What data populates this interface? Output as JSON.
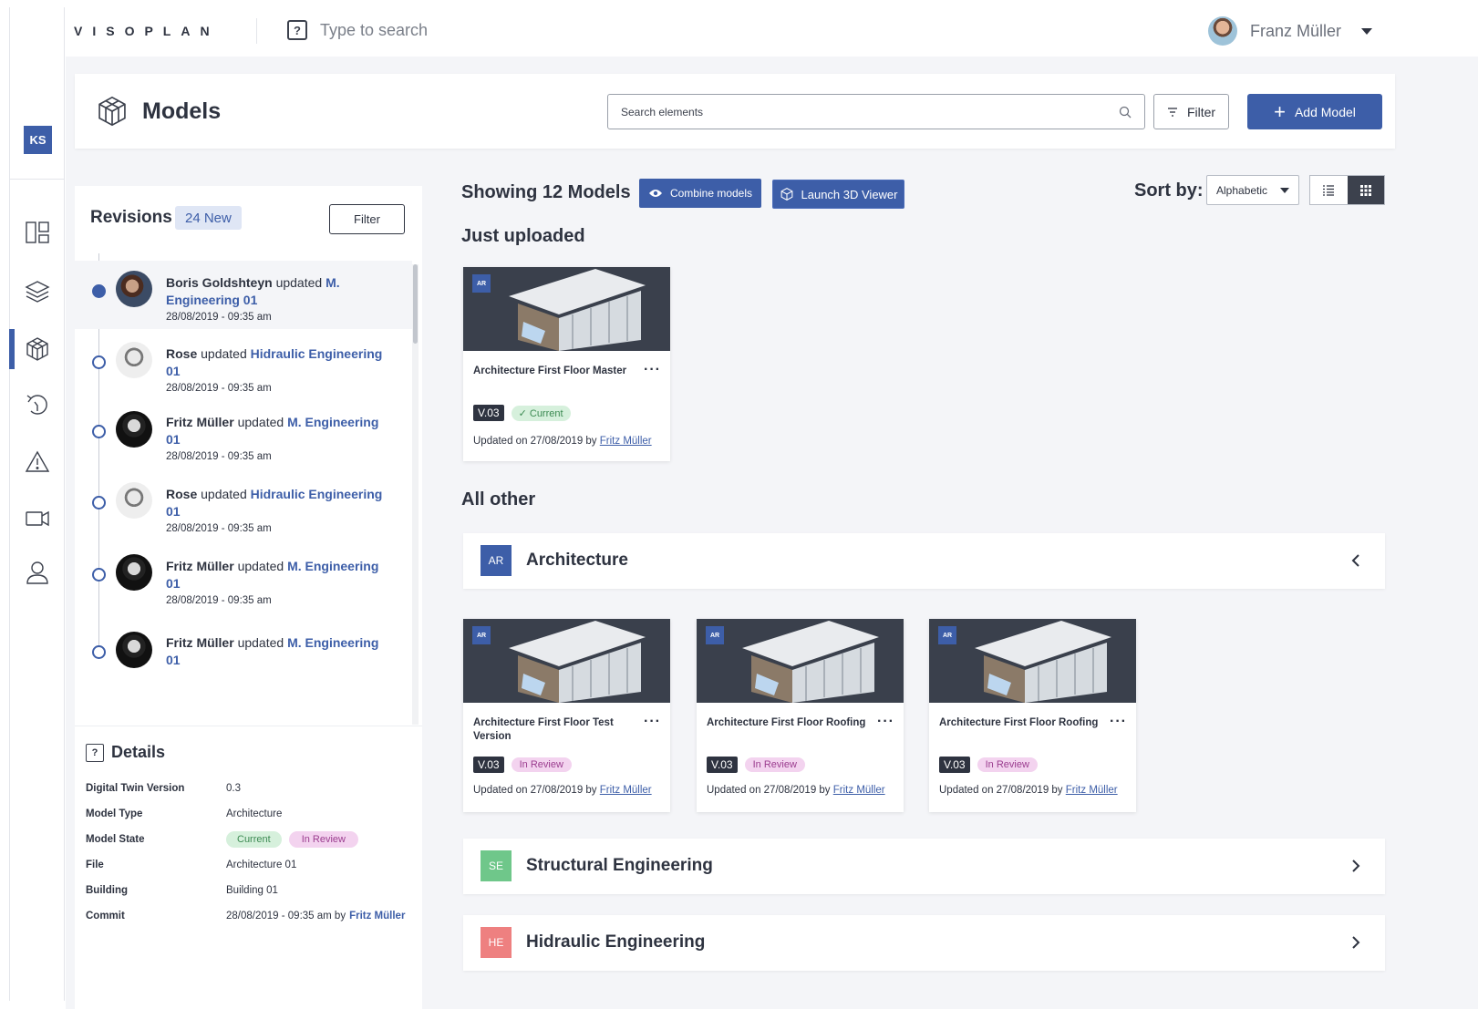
{
  "app": {
    "logo": "VISOPLAN",
    "search_placeholder": "Type to search",
    "user_name": "Franz Müller",
    "workspace_initials": "KS"
  },
  "page": {
    "title": "Models",
    "search_placeholder": "Search elements",
    "filter_label": "Filter",
    "add_label": "Add Model"
  },
  "revisions": {
    "title": "Revisions",
    "new_count": "24 New",
    "filter_label": "Filter",
    "items": [
      {
        "user": "Boris Goldshteyn",
        "action": "updated",
        "target": "M. Engineering 01",
        "date": "28/08/2019 - 09:35 am"
      },
      {
        "user": "Rose",
        "action": "updated",
        "target": "Hidraulic Engineering 01",
        "date": "28/08/2019 - 09:35 am"
      },
      {
        "user": "Fritz Müller",
        "action": "updated",
        "target": "M. Engineering 01",
        "date": "28/08/2019 - 09:35 am"
      },
      {
        "user": "Rose",
        "action": "updated",
        "target": "Hidraulic Engineering 01",
        "date": "28/08/2019 - 09:35 am"
      },
      {
        "user": "Fritz Müller",
        "action": "updated",
        "target": "M. Engineering 01",
        "date": "28/08/2019 - 09:35 am"
      },
      {
        "user": "Fritz Müller",
        "action": "updated",
        "target": "M. Engineering 01",
        "date": ""
      }
    ]
  },
  "details": {
    "title": "Details",
    "rows": [
      {
        "key": "Digital Twin Version",
        "value": "0.3"
      },
      {
        "key": "Model Type",
        "value": "Architecture"
      },
      {
        "key": "Model State",
        "current": "Current",
        "review": "In Review"
      },
      {
        "key": "File",
        "value": "Architecture 01"
      },
      {
        "key": "Building",
        "value": "Building 01"
      },
      {
        "key": "Commit",
        "value": "28/08/2019 - 09:35 am by",
        "link": "Fritz Müller"
      }
    ]
  },
  "toolbar": {
    "showing": "Showing 12 Models",
    "combine": "Combine models",
    "launch": "Launch 3D Viewer",
    "sort_label": "Sort by:",
    "sort_value": "Alphabetic"
  },
  "sections": {
    "just_uploaded": "Just uploaded",
    "all_other": "All other"
  },
  "cards": {
    "uploaded": {
      "badge": "AR",
      "name": "Architecture First Floor Master",
      "version": "V.03",
      "status": "Current",
      "updated": "Updated on 27/08/2019 by",
      "by": "Fritz Müller"
    },
    "architecture": [
      {
        "badge": "AR",
        "name": "Architecture First Floor Test Version",
        "version": "V.03",
        "status": "In Review",
        "updated": "Updated on 27/08/2019 by",
        "by": "Fritz Müller"
      },
      {
        "badge": "AR",
        "name": "Architecture First Floor Roofing",
        "version": "V.03",
        "status": "In Review",
        "updated": "Updated on 27/08/2019 by",
        "by": "Fritz Müller"
      },
      {
        "badge": "AR",
        "name": "Architecture First Floor Roofing",
        "version": "V.03",
        "status": "In Review",
        "updated": "Updated on 27/08/2019 by",
        "by": "Fritz Müller"
      }
    ]
  },
  "groups": [
    {
      "badge": "AR",
      "name": "Architecture",
      "color": "#3d5ea8"
    },
    {
      "badge": "SE",
      "name": "Structural Engineering",
      "color": "#6fc78a"
    },
    {
      "badge": "HE",
      "name": "Hidraulic Engineering",
      "color": "#ee8080"
    }
  ]
}
